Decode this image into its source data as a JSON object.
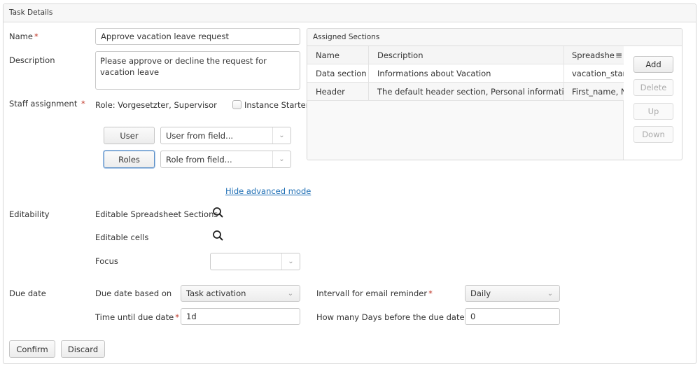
{
  "panel": {
    "title": "Task Details"
  },
  "form": {
    "name": {
      "label": "Name",
      "required": "*",
      "value": "Approve vacation leave request"
    },
    "description": {
      "label": "Description",
      "value": "Please approve or decline the request for vacation leave"
    },
    "staff": {
      "label": "Staff assignment",
      "required": "*",
      "role_text": "Role: Vorgesetzter, Supervisor",
      "instance_starter_label": "Instance Starter",
      "instance_starter_checked": false,
      "user_button": "User",
      "user_select": "User from field...",
      "roles_button": "Roles",
      "role_select": "Role from field...",
      "hide_advanced_link": "Hide advanced mode"
    },
    "editability": {
      "label": "Editability",
      "sections_label": "Editable Spreadsheet Sections",
      "cells_label": "Editable cells",
      "focus_label": "Focus",
      "focus_value": ""
    },
    "due_date": {
      "label": "Due date",
      "based_on_label": "Due date based on",
      "based_on_value": "Task activation",
      "time_until_label": "Time until due date",
      "time_until_required": "*",
      "time_until_value": "1d",
      "reminder_label": "Intervall for email reminder",
      "reminder_required": "*",
      "reminder_value": "Daily",
      "days_before_label": "How many Days before the due date?",
      "days_before_required": "*",
      "days_before_value": "0"
    }
  },
  "assigned_sections": {
    "title": "Assigned Sections",
    "columns": [
      "Name",
      "Description",
      "Spreadshe"
    ],
    "rows": [
      {
        "name": "Data section",
        "description": "Informations about Vacation",
        "spreadsheet": "vacation_start,"
      },
      {
        "name": "Header",
        "description": "The default header section, Personal informations",
        "spreadsheet": "First_name, Na"
      }
    ],
    "buttons": {
      "add": "Add",
      "delete": "Delete",
      "up": "Up",
      "down": "Down"
    }
  },
  "footer": {
    "confirm": "Confirm",
    "discard": "Discard"
  }
}
